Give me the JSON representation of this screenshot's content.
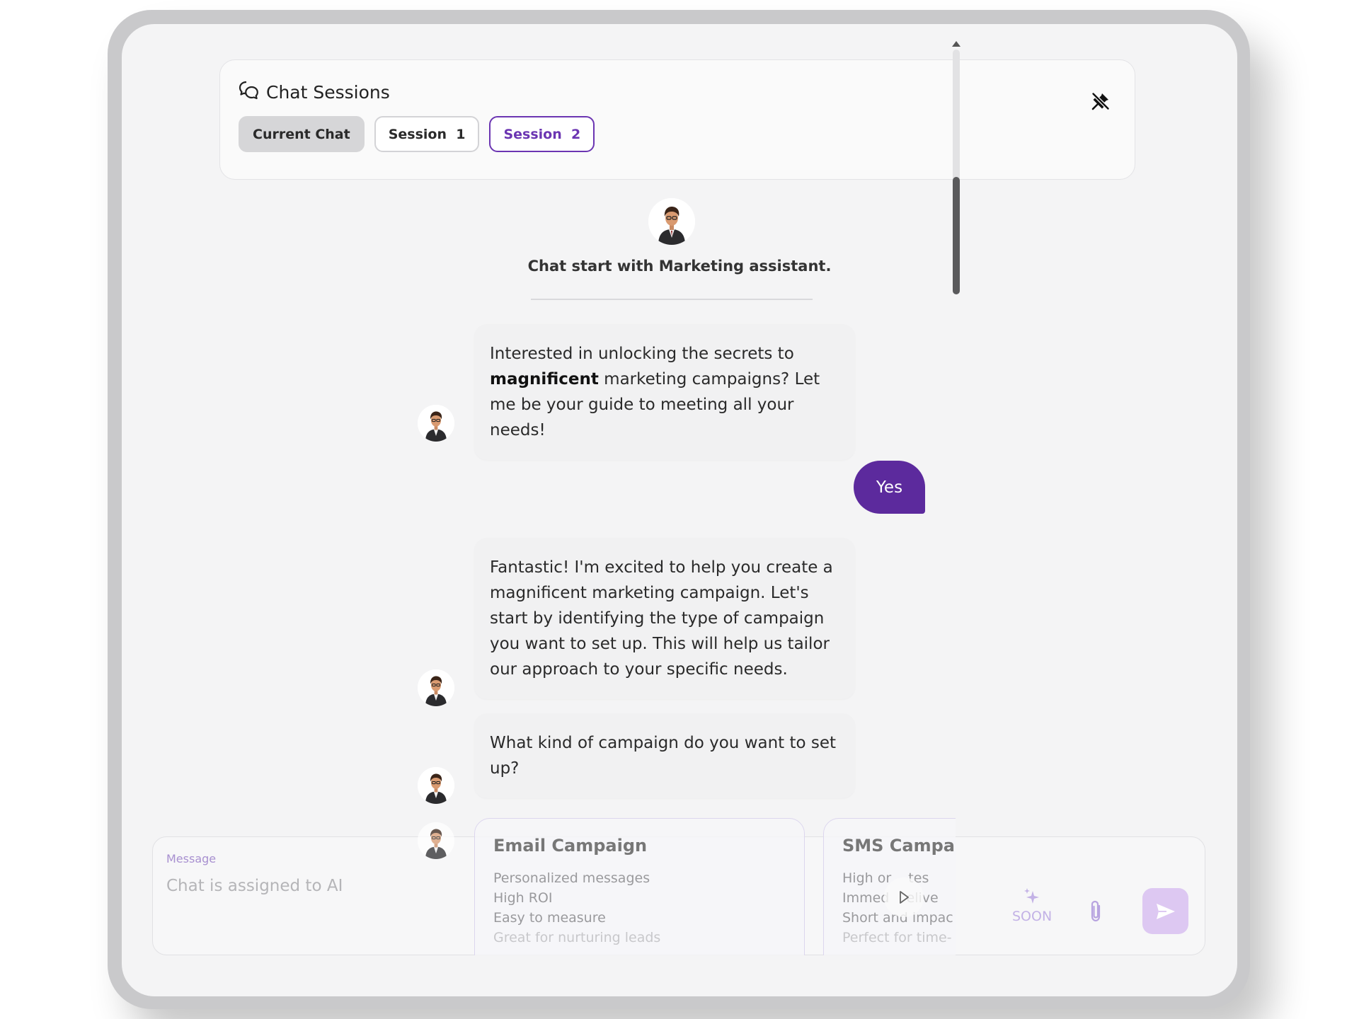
{
  "sessions": {
    "title": "Chat Sessions",
    "tabs": [
      {
        "label": "Current Chat",
        "state": "current"
      },
      {
        "label": "Session  1",
        "state": "default"
      },
      {
        "label": "Session  2",
        "state": "selected"
      }
    ],
    "pin_icon": "pin-off-icon"
  },
  "chat": {
    "start_text": "Chat start with Marketing assistant.",
    "messages": [
      {
        "role": "assistant",
        "text_before": "Interested in unlocking the secrets to ",
        "bold": "magnificent",
        "text_after": " marketing campaigns? Let me be your guide to meeting all your needs!"
      },
      {
        "role": "user",
        "text": "Yes"
      },
      {
        "role": "assistant",
        "text": "Fantastic! I'm excited to help you create a magnificent marketing campaign. Let's start by identifying the type of campaign you want to set up. This will help us tailor our approach to your specific needs."
      },
      {
        "role": "assistant",
        "text": "What kind of campaign do you want to set up?"
      }
    ],
    "options": [
      {
        "title": "Email Campaign",
        "lines": [
          "Personalized messages",
          "High ROI",
          "Easy to measure",
          "Great for nurturing leads"
        ]
      },
      {
        "title": "SMS Campaig",
        "lines": [
          "High or    tes",
          "Immed    elive",
          "Short and impac",
          "Perfect for time-"
        ]
      }
    ]
  },
  "composer": {
    "label": "Message",
    "placeholder": "Chat is assigned to AI",
    "soon_label": "SOON"
  },
  "colors": {
    "accent": "#5c2a9d",
    "accent_light": "#ddc8f2",
    "background": "#f4f4f5"
  }
}
